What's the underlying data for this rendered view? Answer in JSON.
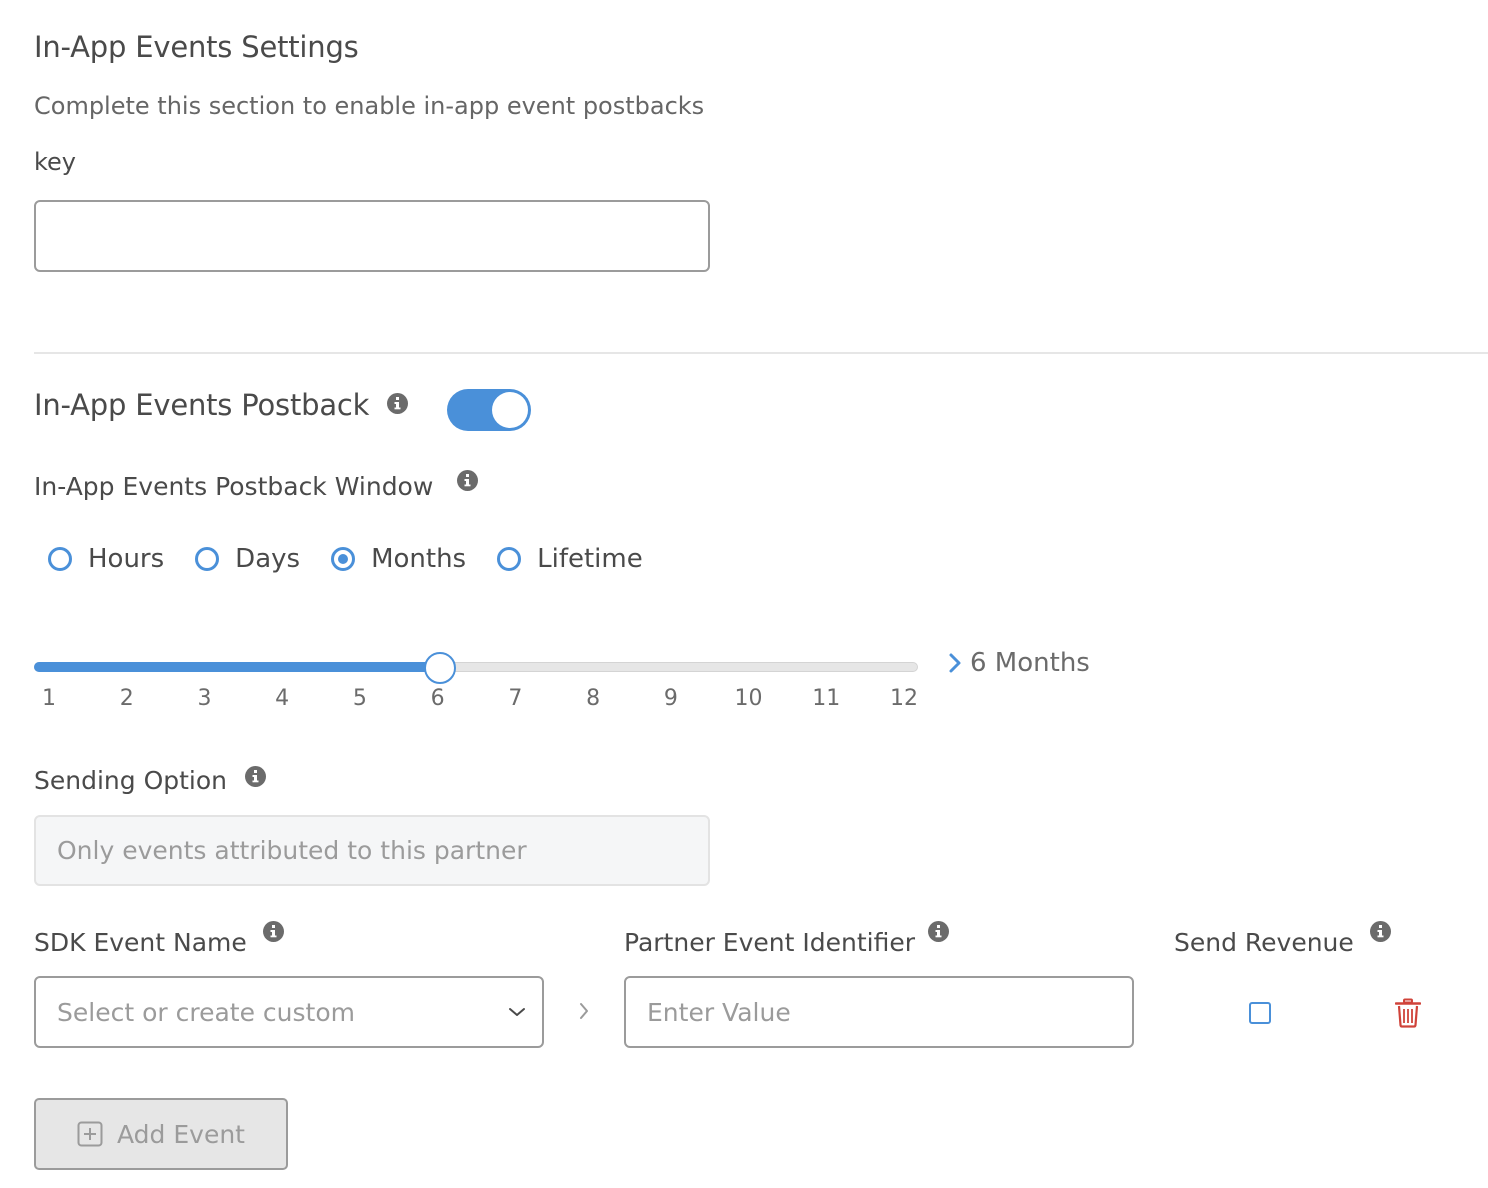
{
  "settings": {
    "title": "In-App Events Settings",
    "subtitle": "Complete this section to enable in-app event postbacks",
    "key_label": "key",
    "key_value": ""
  },
  "postback": {
    "title": "In-App Events Postback",
    "enabled": true,
    "window_label": "In-App Events Postback Window",
    "window_options": [
      {
        "label": "Hours",
        "checked": false
      },
      {
        "label": "Days",
        "checked": false
      },
      {
        "label": "Months",
        "checked": true
      },
      {
        "label": "Lifetime",
        "checked": false
      }
    ],
    "slider": {
      "min": 1,
      "max": 12,
      "value": 6,
      "ticks": [
        "1",
        "2",
        "3",
        "4",
        "5",
        "6",
        "7",
        "8",
        "9",
        "10",
        "11",
        "12"
      ],
      "value_label": "6 Months"
    }
  },
  "sending": {
    "label": "Sending Option",
    "value": "Only events attributed to this partner"
  },
  "events": {
    "sdk_label": "SDK Event Name",
    "partner_label": "Partner Event Identifier",
    "revenue_label": "Send Revenue",
    "sdk_placeholder": "Select or create custom",
    "partner_placeholder": "Enter Value",
    "send_revenue": false,
    "add_label": "Add Event"
  },
  "colors": {
    "accent": "#4a90d9",
    "danger": "#d0433a",
    "text": "#4a4a4a",
    "muted": "#9b9b9b"
  }
}
